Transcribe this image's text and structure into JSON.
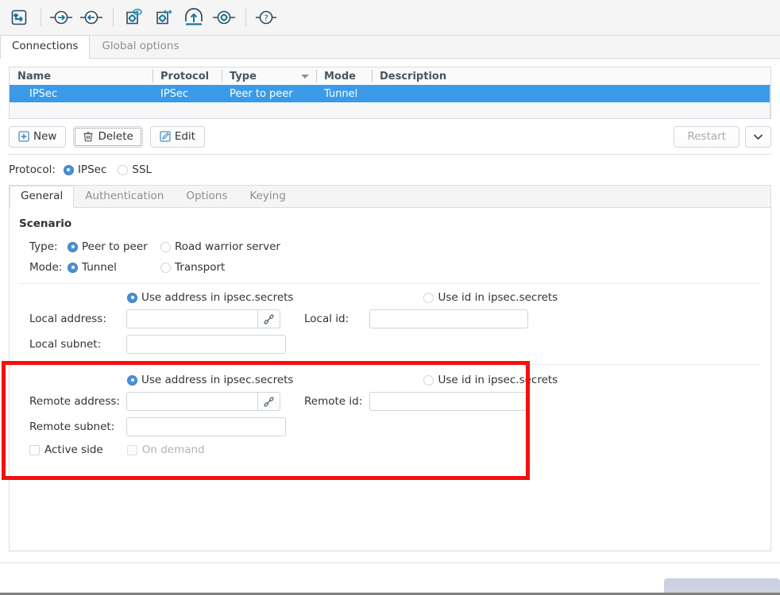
{
  "toolbar": {
    "buttons": [
      {
        "name": "import-icon",
        "title": "Import"
      },
      {
        "name": "arrow-right-icon",
        "title": "Forward"
      },
      {
        "name": "arrow-left-icon",
        "title": "Back"
      },
      {
        "name": "view-config-icon",
        "title": "View configuration"
      },
      {
        "name": "transfer-config-icon",
        "title": "Transfer configuration"
      },
      {
        "name": "upload-cloud-icon",
        "title": "Upload"
      },
      {
        "name": "settings-gear-icon",
        "title": "Settings"
      },
      {
        "name": "help-question-icon",
        "title": "Help"
      }
    ]
  },
  "top_tabs": [
    {
      "label": "Connections",
      "active": true
    },
    {
      "label": "Global options",
      "active": false
    }
  ],
  "connection_list": {
    "columns": [
      "Name",
      "Protocol",
      "Type",
      "Mode",
      "Description"
    ],
    "sorted_column": "Type",
    "sort_direction": "descending",
    "rows": [
      {
        "name": "IPSec",
        "protocol": "IPSec",
        "type": "Peer to peer",
        "mode": "Tunnel",
        "description": ""
      }
    ],
    "selected_row_color": "#3b9ae8"
  },
  "actions": {
    "new_label": "New",
    "delete_label": "Delete",
    "edit_label": "Edit",
    "restart_label": "Restart",
    "restart_menu_icon": "chevron-down-icon"
  },
  "protocol": {
    "label": "Protocol:",
    "options": [
      {
        "label": "IPSec",
        "selected": true
      },
      {
        "label": "SSL",
        "selected": false
      }
    ]
  },
  "inner_tabs": [
    {
      "label": "General",
      "active": true
    },
    {
      "label": "Authentication",
      "active": false
    },
    {
      "label": "Options",
      "active": false
    },
    {
      "label": "Keying",
      "active": false
    }
  ],
  "scenario": {
    "title": "Scenario",
    "type": {
      "label": "Type:",
      "options": [
        {
          "label": "Peer to peer",
          "selected": true
        },
        {
          "label": "Road warrior server",
          "selected": false
        }
      ]
    },
    "mode": {
      "label": "Mode:",
      "options": [
        {
          "label": "Tunnel",
          "selected": true
        },
        {
          "label": "Transport",
          "selected": false
        }
      ]
    }
  },
  "local": {
    "use_address_label": "Use address in ipsec.secrets",
    "use_address_selected": true,
    "use_id_label": "Use id in ipsec.secrets",
    "use_id_selected": false,
    "address_label": "Local address:",
    "address_value": "",
    "address_link_icon": "link-chain-icon",
    "id_label": "Local id:",
    "id_value": "",
    "subnet_label": "Local subnet:",
    "subnet_value": ""
  },
  "remote": {
    "use_address_label": "Use address in ipsec.secrets",
    "use_address_selected": true,
    "use_id_label": "Use id in ipsec.secrets",
    "use_id_selected": false,
    "address_label": "Remote address:",
    "address_value": "",
    "address_link_icon": "link-chain-icon",
    "id_label": "Remote id:",
    "id_value": "",
    "subnet_label": "Remote subnet:",
    "subnet_value": "",
    "active_side_label": "Active side",
    "active_side_checked": false,
    "on_demand_label": "On demand",
    "on_demand_checked": false,
    "on_demand_disabled": true,
    "highlight_color": "#f50e0e"
  }
}
